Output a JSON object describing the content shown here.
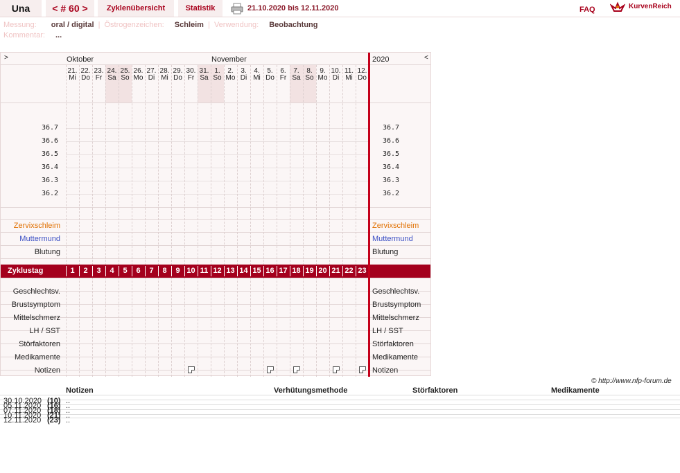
{
  "topbar": {
    "name": "Una",
    "cycle_nav": "< # 60 >",
    "tab_overview": "Zyklenübersicht",
    "tab_stats": "Statistik",
    "date_range": "21.10.2020 bis 12.11.2020",
    "faq": "FAQ",
    "logo": "KurvenReich"
  },
  "meta": {
    "measure_label": "Messung:",
    "measure_value": "oral / digital",
    "estrogen_label": "Östrogenzeichen:",
    "estrogen_value": "Schleim",
    "usage_label": "Verwendung:",
    "usage_value": "Beobachtung",
    "comment_label": "Kommentar:",
    "comment_value": "..."
  },
  "chart": {
    "nav_left": ">",
    "nav_right": "<",
    "month_oct": "Oktober",
    "month_nov": "November",
    "year": "2020",
    "days": [
      {
        "d": "21.",
        "w": "Mi"
      },
      {
        "d": "22.",
        "w": "Do"
      },
      {
        "d": "23.",
        "w": "Fr"
      },
      {
        "d": "24.",
        "w": "Sa"
      },
      {
        "d": "25.",
        "w": "So"
      },
      {
        "d": "26.",
        "w": "Mo"
      },
      {
        "d": "27.",
        "w": "Di"
      },
      {
        "d": "28.",
        "w": "Mi"
      },
      {
        "d": "29.",
        "w": "Do"
      },
      {
        "d": "30.",
        "w": "Fr"
      },
      {
        "d": "31.",
        "w": "Sa"
      },
      {
        "d": "1.",
        "w": "So"
      },
      {
        "d": "2.",
        "w": "Mo"
      },
      {
        "d": "3.",
        "w": "Di"
      },
      {
        "d": "4.",
        "w": "Mi"
      },
      {
        "d": "5.",
        "w": "Do"
      },
      {
        "d": "6.",
        "w": "Fr"
      },
      {
        "d": "7.",
        "w": "Sa"
      },
      {
        "d": "8.",
        "w": "So"
      },
      {
        "d": "9.",
        "w": "Mo"
      },
      {
        "d": "10.",
        "w": "Di"
      },
      {
        "d": "11.",
        "w": "Mi"
      },
      {
        "d": "12.",
        "w": "Do"
      }
    ],
    "weekend_idx": [
      3,
      4,
      10,
      11,
      17,
      18
    ],
    "temps": [
      "36.7",
      "36.6",
      "36.5",
      "36.4",
      "36.3",
      "36.2"
    ],
    "row_cervix": "Zervixschleim",
    "row_cervix_r": "Zervixschleim",
    "row_muttermund": "Muttermund",
    "row_muttermund_r": "Muttermund",
    "row_blutung": "Blutung",
    "row_blutung_r": "Blutung",
    "zyklustag": "Zyklustag",
    "cycle_days": [
      "1",
      "2",
      "3",
      "4",
      "5",
      "6",
      "7",
      "8",
      "9",
      "10",
      "11",
      "12",
      "13",
      "14",
      "15",
      "16",
      "17",
      "18",
      "19",
      "20",
      "21",
      "22",
      "23"
    ],
    "lower_rows": [
      "Geschlechtsv.",
      "Brustsymptom",
      "Mittelschmerz",
      "LH / SST",
      "Störfaktoren",
      "Medikamente",
      "Notizen"
    ],
    "lower_rows_r": [
      "Geschlechtsv.",
      "Brustsymptom",
      "Mittelschmerz",
      "LH / SST",
      "Störfaktoren",
      "Medikamente",
      "Notizen"
    ],
    "note_idx": [
      9,
      15,
      17,
      20,
      22
    ],
    "colors": {
      "accent": "#a4001d",
      "cervix": "#e07000",
      "muttermund": "#3b4fc4",
      "redline": "#c4001a"
    }
  },
  "copyright": "© http://www.nfp-forum.de",
  "notes": {
    "headers": [
      "Notizen",
      "Verhütungsmethode",
      "Störfaktoren",
      "Medikamente"
    ],
    "rows": [
      {
        "date": "30.10.2020",
        "day": "(10)",
        "text": ".."
      },
      {
        "date": "05.11.2020",
        "day": "(16)",
        "text": ".."
      },
      {
        "date": "07.11.2020",
        "day": "(18)",
        "text": ".."
      },
      {
        "date": "10.11.2020",
        "day": "(21)",
        "text": ".."
      },
      {
        "date": "12.11.2020",
        "day": "(23)",
        "text": ".."
      }
    ]
  }
}
